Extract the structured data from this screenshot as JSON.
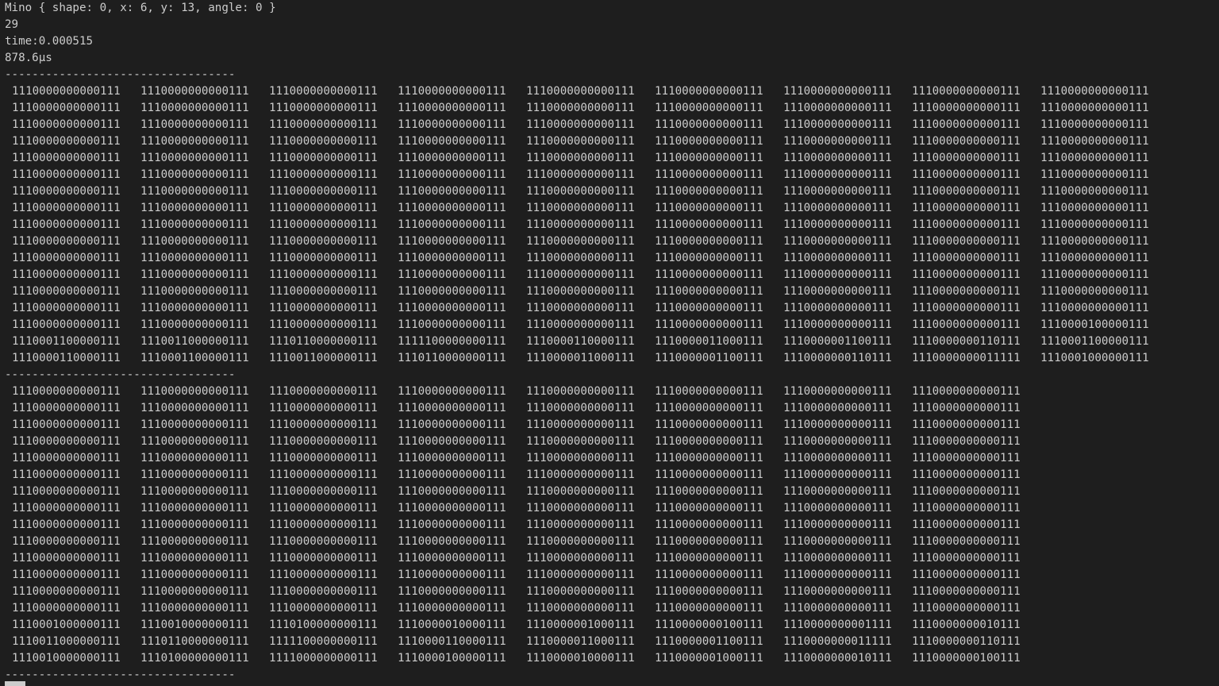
{
  "header": {
    "mino": "Mino { shape: 0, x: 6, y: 13, angle: 0 }",
    "count": "29",
    "time": "time:0.000515",
    "elapsed": "878.6µs"
  },
  "separator": "----------------------------------",
  "block1": {
    "rows": [
      [
        "1110000000000111",
        "1110000000000111",
        "1110000000000111",
        "1110000000000111",
        "1110000000000111",
        "1110000000000111",
        "1110000000000111",
        "1110000000000111",
        "1110000000000111"
      ],
      [
        "1110000000000111",
        "1110000000000111",
        "1110000000000111",
        "1110000000000111",
        "1110000000000111",
        "1110000000000111",
        "1110000000000111",
        "1110000000000111",
        "1110000000000111"
      ],
      [
        "1110000000000111",
        "1110000000000111",
        "1110000000000111",
        "1110000000000111",
        "1110000000000111",
        "1110000000000111",
        "1110000000000111",
        "1110000000000111",
        "1110000000000111"
      ],
      [
        "1110000000000111",
        "1110000000000111",
        "1110000000000111",
        "1110000000000111",
        "1110000000000111",
        "1110000000000111",
        "1110000000000111",
        "1110000000000111",
        "1110000000000111"
      ],
      [
        "1110000000000111",
        "1110000000000111",
        "1110000000000111",
        "1110000000000111",
        "1110000000000111",
        "1110000000000111",
        "1110000000000111",
        "1110000000000111",
        "1110000000000111"
      ],
      [
        "1110000000000111",
        "1110000000000111",
        "1110000000000111",
        "1110000000000111",
        "1110000000000111",
        "1110000000000111",
        "1110000000000111",
        "1110000000000111",
        "1110000000000111"
      ],
      [
        "1110000000000111",
        "1110000000000111",
        "1110000000000111",
        "1110000000000111",
        "1110000000000111",
        "1110000000000111",
        "1110000000000111",
        "1110000000000111",
        "1110000000000111"
      ],
      [
        "1110000000000111",
        "1110000000000111",
        "1110000000000111",
        "1110000000000111",
        "1110000000000111",
        "1110000000000111",
        "1110000000000111",
        "1110000000000111",
        "1110000000000111"
      ],
      [
        "1110000000000111",
        "1110000000000111",
        "1110000000000111",
        "1110000000000111",
        "1110000000000111",
        "1110000000000111",
        "1110000000000111",
        "1110000000000111",
        "1110000000000111"
      ],
      [
        "1110000000000111",
        "1110000000000111",
        "1110000000000111",
        "1110000000000111",
        "1110000000000111",
        "1110000000000111",
        "1110000000000111",
        "1110000000000111",
        "1110000000000111"
      ],
      [
        "1110000000000111",
        "1110000000000111",
        "1110000000000111",
        "1110000000000111",
        "1110000000000111",
        "1110000000000111",
        "1110000000000111",
        "1110000000000111",
        "1110000000000111"
      ],
      [
        "1110000000000111",
        "1110000000000111",
        "1110000000000111",
        "1110000000000111",
        "1110000000000111",
        "1110000000000111",
        "1110000000000111",
        "1110000000000111",
        "1110000000000111"
      ],
      [
        "1110000000000111",
        "1110000000000111",
        "1110000000000111",
        "1110000000000111",
        "1110000000000111",
        "1110000000000111",
        "1110000000000111",
        "1110000000000111",
        "1110000000000111"
      ],
      [
        "1110000000000111",
        "1110000000000111",
        "1110000000000111",
        "1110000000000111",
        "1110000000000111",
        "1110000000000111",
        "1110000000000111",
        "1110000000000111",
        "1110000000000111"
      ],
      [
        "1110000000000111",
        "1110000000000111",
        "1110000000000111",
        "1110000000000111",
        "1110000000000111",
        "1110000000000111",
        "1110000000000111",
        "1110000000000111",
        "1110000100000111"
      ],
      [
        "1110001100000111",
        "1110011000000111",
        "1110110000000111",
        "1111100000000111",
        "1110000110000111",
        "1110000011000111",
        "1110000001100111",
        "1110000000110111",
        "1110001100000111"
      ],
      [
        "1110000110000111",
        "1110001100000111",
        "1110011000000111",
        "1110110000000111",
        "1110000011000111",
        "1110000001100111",
        "1110000000110111",
        "1110000000011111",
        "1110001000000111"
      ]
    ]
  },
  "block2": {
    "rows": [
      [
        "1110000000000111",
        "1110000000000111",
        "1110000000000111",
        "1110000000000111",
        "1110000000000111",
        "1110000000000111",
        "1110000000000111",
        "1110000000000111"
      ],
      [
        "1110000000000111",
        "1110000000000111",
        "1110000000000111",
        "1110000000000111",
        "1110000000000111",
        "1110000000000111",
        "1110000000000111",
        "1110000000000111"
      ],
      [
        "1110000000000111",
        "1110000000000111",
        "1110000000000111",
        "1110000000000111",
        "1110000000000111",
        "1110000000000111",
        "1110000000000111",
        "1110000000000111"
      ],
      [
        "1110000000000111",
        "1110000000000111",
        "1110000000000111",
        "1110000000000111",
        "1110000000000111",
        "1110000000000111",
        "1110000000000111",
        "1110000000000111"
      ],
      [
        "1110000000000111",
        "1110000000000111",
        "1110000000000111",
        "1110000000000111",
        "1110000000000111",
        "1110000000000111",
        "1110000000000111",
        "1110000000000111"
      ],
      [
        "1110000000000111",
        "1110000000000111",
        "1110000000000111",
        "1110000000000111",
        "1110000000000111",
        "1110000000000111",
        "1110000000000111",
        "1110000000000111"
      ],
      [
        "1110000000000111",
        "1110000000000111",
        "1110000000000111",
        "1110000000000111",
        "1110000000000111",
        "1110000000000111",
        "1110000000000111",
        "1110000000000111"
      ],
      [
        "1110000000000111",
        "1110000000000111",
        "1110000000000111",
        "1110000000000111",
        "1110000000000111",
        "1110000000000111",
        "1110000000000111",
        "1110000000000111"
      ],
      [
        "1110000000000111",
        "1110000000000111",
        "1110000000000111",
        "1110000000000111",
        "1110000000000111",
        "1110000000000111",
        "1110000000000111",
        "1110000000000111"
      ],
      [
        "1110000000000111",
        "1110000000000111",
        "1110000000000111",
        "1110000000000111",
        "1110000000000111",
        "1110000000000111",
        "1110000000000111",
        "1110000000000111"
      ],
      [
        "1110000000000111",
        "1110000000000111",
        "1110000000000111",
        "1110000000000111",
        "1110000000000111",
        "1110000000000111",
        "1110000000000111",
        "1110000000000111"
      ],
      [
        "1110000000000111",
        "1110000000000111",
        "1110000000000111",
        "1110000000000111",
        "1110000000000111",
        "1110000000000111",
        "1110000000000111",
        "1110000000000111"
      ],
      [
        "1110000000000111",
        "1110000000000111",
        "1110000000000111",
        "1110000000000111",
        "1110000000000111",
        "1110000000000111",
        "1110000000000111",
        "1110000000000111"
      ],
      [
        "1110000000000111",
        "1110000000000111",
        "1110000000000111",
        "1110000000000111",
        "1110000000000111",
        "1110000000000111",
        "1110000000000111",
        "1110000000000111"
      ],
      [
        "1110001000000111",
        "1110010000000111",
        "1110100000000111",
        "1110000010000111",
        "1110000001000111",
        "1110000000100111",
        "1110000000001111",
        "1110000000010111"
      ],
      [
        "1110011000000111",
        "1110110000000111",
        "1111100000000111",
        "1110000110000111",
        "1110000011000111",
        "1110000001100111",
        "1110000000011111",
        "1110000000110111"
      ],
      [
        "1110010000000111",
        "1110100000000111",
        "1111000000000111",
        "1110000100000111",
        "1110000010000111",
        "1110000001000111",
        "1110000000010111",
        "1110000000100111"
      ]
    ]
  }
}
